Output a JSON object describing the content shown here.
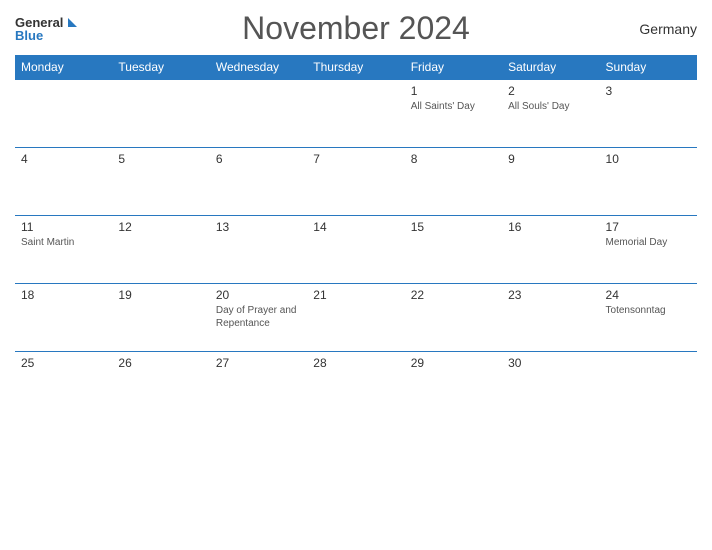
{
  "header": {
    "logo_general": "General",
    "logo_blue": "Blue",
    "title": "November 2024",
    "country": "Germany"
  },
  "weekdays": [
    "Monday",
    "Tuesday",
    "Wednesday",
    "Thursday",
    "Friday",
    "Saturday",
    "Sunday"
  ],
  "weeks": [
    [
      {
        "day": "",
        "holiday": ""
      },
      {
        "day": "",
        "holiday": ""
      },
      {
        "day": "",
        "holiday": ""
      },
      {
        "day": "",
        "holiday": ""
      },
      {
        "day": "1",
        "holiday": "All Saints' Day"
      },
      {
        "day": "2",
        "holiday": "All Souls' Day"
      },
      {
        "day": "3",
        "holiday": ""
      }
    ],
    [
      {
        "day": "4",
        "holiday": ""
      },
      {
        "day": "5",
        "holiday": ""
      },
      {
        "day": "6",
        "holiday": ""
      },
      {
        "day": "7",
        "holiday": ""
      },
      {
        "day": "8",
        "holiday": ""
      },
      {
        "day": "9",
        "holiday": ""
      },
      {
        "day": "10",
        "holiday": ""
      }
    ],
    [
      {
        "day": "11",
        "holiday": "Saint Martin"
      },
      {
        "day": "12",
        "holiday": ""
      },
      {
        "day": "13",
        "holiday": ""
      },
      {
        "day": "14",
        "holiday": ""
      },
      {
        "day": "15",
        "holiday": ""
      },
      {
        "day": "16",
        "holiday": ""
      },
      {
        "day": "17",
        "holiday": "Memorial Day"
      }
    ],
    [
      {
        "day": "18",
        "holiday": ""
      },
      {
        "day": "19",
        "holiday": ""
      },
      {
        "day": "20",
        "holiday": "Day of Prayer and Repentance"
      },
      {
        "day": "21",
        "holiday": ""
      },
      {
        "day": "22",
        "holiday": ""
      },
      {
        "day": "23",
        "holiday": ""
      },
      {
        "day": "24",
        "holiday": "Totensonntag"
      }
    ],
    [
      {
        "day": "25",
        "holiday": ""
      },
      {
        "day": "26",
        "holiday": ""
      },
      {
        "day": "27",
        "holiday": ""
      },
      {
        "day": "28",
        "holiday": ""
      },
      {
        "day": "29",
        "holiday": ""
      },
      {
        "day": "30",
        "holiday": ""
      },
      {
        "day": "",
        "holiday": ""
      }
    ]
  ]
}
